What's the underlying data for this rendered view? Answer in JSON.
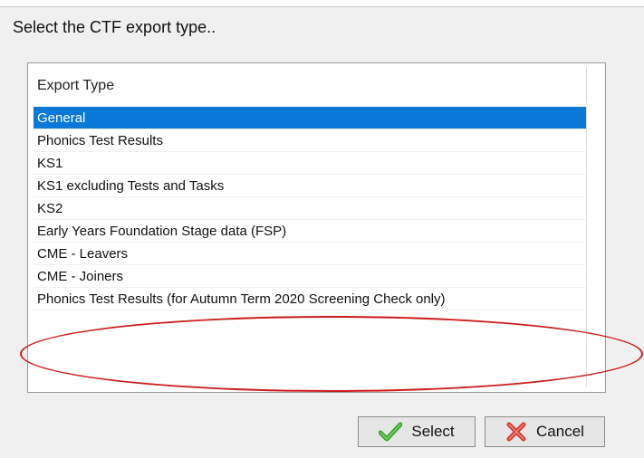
{
  "dialog": {
    "prompt": "Select the CTF export type.."
  },
  "list": {
    "header": "Export Type",
    "items": [
      {
        "label": "General",
        "selected": true
      },
      {
        "label": "Phonics Test Results",
        "selected": false
      },
      {
        "label": "KS1",
        "selected": false
      },
      {
        "label": "KS1 excluding Tests and Tasks",
        "selected": false
      },
      {
        "label": "KS2",
        "selected": false
      },
      {
        "label": "Early Years Foundation Stage data (FSP)",
        "selected": false
      },
      {
        "label": "CME - Leavers",
        "selected": false
      },
      {
        "label": "CME - Joiners",
        "selected": false
      },
      {
        "label": "Phonics Test Results (for Autumn Term 2020 Screening Check only)",
        "selected": false
      }
    ]
  },
  "buttons": {
    "select_label": "Select",
    "cancel_label": "Cancel"
  },
  "icons": {
    "select": "checkmark-icon",
    "cancel": "x-cross-icon"
  },
  "colors": {
    "selection": "#0a78d7",
    "annotation": "#cc1b1b",
    "check": "#3aa52a",
    "cross": "#d9342b"
  }
}
